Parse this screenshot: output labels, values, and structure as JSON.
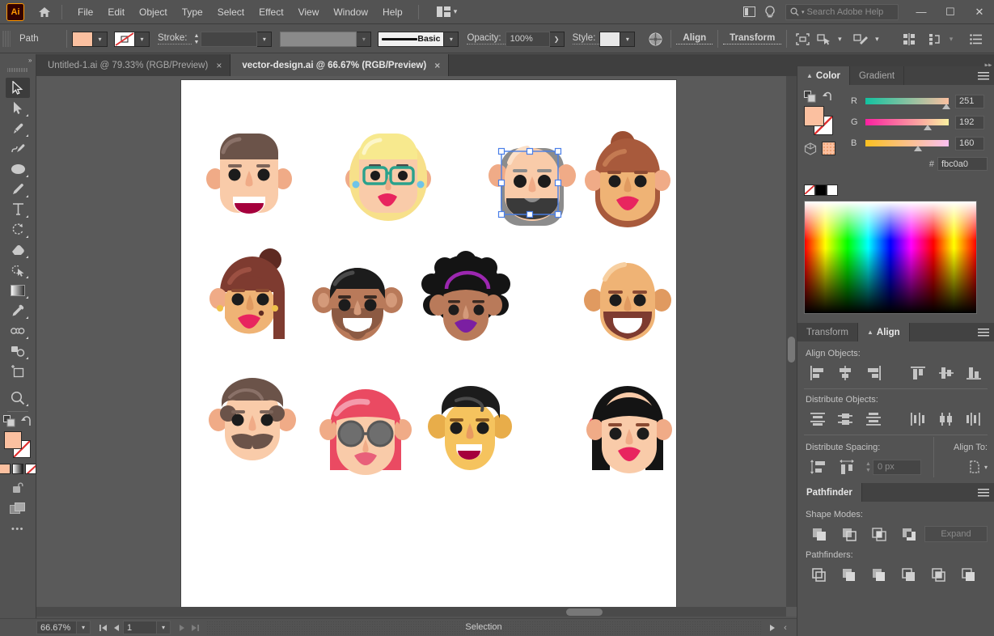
{
  "app": {
    "name": "Ai",
    "logo_color": "#ff9a00"
  },
  "menubar": {
    "items": [
      {
        "label": "File"
      },
      {
        "label": "Edit"
      },
      {
        "label": "Object"
      },
      {
        "label": "Type"
      },
      {
        "label": "Select"
      },
      {
        "label": "Effect"
      },
      {
        "label": "View"
      },
      {
        "label": "Window"
      },
      {
        "label": "Help"
      }
    ],
    "home_icon": "home-icon",
    "arrange_icon": "arrange-documents-icon",
    "properties_icon": "properties-panel-icon",
    "tips_icon": "lightbulb-icon",
    "search": {
      "placeholder": "Search Adobe Help",
      "value": ""
    },
    "window_controls": {
      "minimize": "—",
      "maximize": "☐",
      "close": "✕"
    }
  },
  "controlbar": {
    "object_type": "Path",
    "fill_color": "#fbc0a0",
    "stroke_color": "none",
    "stroke_label": "Stroke:",
    "stroke_weight": "",
    "variable_width": "",
    "brush_label": "Basic",
    "opacity_label": "Opacity:",
    "opacity_value": "100%",
    "style_label": "Style:",
    "style_swatch": "#e8e8e8",
    "align_label": "Align",
    "transform_label": "Transform",
    "icons": [
      "isolate-selected-object-icon",
      "select-similar-objects-icon",
      "recolor-artwork-icon",
      "distribute-icon",
      "arrange-icon",
      "document-setup-icon"
    ]
  },
  "tabs": [
    {
      "label": "Untitled-1.ai @ 79.33% (RGB/Preview)",
      "active": false,
      "close": "×"
    },
    {
      "label": "vector-design.ai @ 66.67% (RGB/Preview)",
      "active": true,
      "close": "×"
    }
  ],
  "toolbar": {
    "expand_chevron": "»",
    "tools": [
      {
        "name": "selection-tool",
        "active": true,
        "has_flyout": false
      },
      {
        "name": "direct-selection-tool",
        "active": false,
        "has_flyout": true
      },
      {
        "name": "pen-tool",
        "active": false,
        "has_flyout": true
      },
      {
        "name": "curvature-tool",
        "active": false,
        "has_flyout": false
      },
      {
        "name": "ellipse-tool",
        "active": false,
        "has_flyout": true
      },
      {
        "name": "paintbrush-tool",
        "active": false,
        "has_flyout": true
      },
      {
        "name": "type-tool",
        "active": false,
        "has_flyout": true
      },
      {
        "name": "rotate-tool",
        "active": false,
        "has_flyout": true
      },
      {
        "name": "eraser-tool",
        "active": false,
        "has_flyout": true
      },
      {
        "name": "shaper-tool",
        "active": false,
        "has_flyout": true
      },
      {
        "name": "gradient-tool",
        "active": false,
        "has_flyout": true
      },
      {
        "name": "eyedropper-tool",
        "active": false,
        "has_flyout": true
      },
      {
        "name": "blend-tool",
        "active": false,
        "has_flyout": true
      },
      {
        "name": "shape-builder-tool",
        "active": false,
        "has_flyout": true
      },
      {
        "name": "artboard-tool",
        "active": false,
        "has_flyout": false
      },
      {
        "name": "zoom-tool",
        "active": false,
        "has_flyout": true
      }
    ],
    "fill_color": "#fbc0a0",
    "stroke_color": "none",
    "more_tools": "•••"
  },
  "canvas": {
    "artboard_bg": "#ffffff",
    "selection": {
      "color": "#4a7fe8",
      "target": "avatar-bald-man-gray-beard",
      "handles": 8
    },
    "avatars": [
      {
        "id": "avatar-brown-hair-man",
        "row": 1,
        "col": 1,
        "skin": "#f7c9a8",
        "hair": "#6b544b",
        "mouth": "#c2185b"
      },
      {
        "id": "avatar-blonde-glasses-woman",
        "row": 1,
        "col": 2,
        "skin": "#f7c9a8",
        "hair": "#f7e98e",
        "glasses": "#2fa08a",
        "mouth": "#e8255f"
      },
      {
        "id": "avatar-bald-man-gray-beard",
        "row": 1,
        "col": 3,
        "skin": "#f7c9a8",
        "beard": "#8c8c8c",
        "selected": true
      },
      {
        "id": "avatar-bun-brown-woman",
        "row": 1,
        "col": 4,
        "skin": "#f0b97e",
        "hair": "#8a4a3a",
        "mouth": "#e8255f"
      },
      {
        "id": "avatar-redhead-bun-woman",
        "row": 2,
        "col": 1,
        "skin": "#f0b97e",
        "hair": "#7e3b30",
        "mouth": "#e8255f"
      },
      {
        "id": "avatar-beard-man",
        "row": 2,
        "col": 2,
        "skin": "#b97a5a",
        "hair": "#1c1c1c",
        "beard": "#8c5a43"
      },
      {
        "id": "avatar-afro-woman",
        "row": 2,
        "col": 3,
        "skin": "#b97a5a",
        "hair": "#141414",
        "headband": "#9c27b0",
        "mouth": "#7b1fa2"
      },
      {
        "id": "avatar-bald-beard-man",
        "row": 2,
        "col": 4,
        "skin": "#f0b97e",
        "beard": "#7e3b30"
      },
      {
        "id": "avatar-mustache-man",
        "row": 3,
        "col": 1,
        "skin": "#f7c9a8",
        "hair": "#6b544b",
        "mustache": "#6b544b"
      },
      {
        "id": "avatar-pinkhair-sunglasses-woman",
        "row": 3,
        "col": 2,
        "skin": "#f7c9a8",
        "hair": "#ea4a62",
        "sunglasses": "#5a5a5a"
      },
      {
        "id": "avatar-young-man",
        "row": 3,
        "col": 3,
        "skin": "#f5c35e",
        "hair": "#1c1c1c",
        "mouth": "#c2185b"
      },
      {
        "id": "avatar-blackhair-flower-woman",
        "row": 3,
        "col": 4,
        "skin": "#f7c9a8",
        "hair": "#141414",
        "flower": "#ea4a62",
        "mouth": "#e8255f"
      }
    ]
  },
  "color_panel": {
    "tabs": [
      {
        "label": "Color",
        "active": true
      },
      {
        "label": "Gradient",
        "active": false
      }
    ],
    "channels": [
      {
        "label": "R",
        "value": "251",
        "pos": 0.985
      },
      {
        "label": "G",
        "value": "192",
        "pos": 0.755
      },
      {
        "label": "B",
        "value": "160",
        "pos": 0.627
      }
    ],
    "hex_label": "#",
    "hex_value": "fbc0a0",
    "fill_color": "#fbc0a0",
    "quick_swatches": [
      "none",
      "#000000",
      "#ffffff"
    ]
  },
  "align_panel": {
    "tabs": [
      {
        "label": "Transform",
        "active": false
      },
      {
        "label": "Align",
        "active": true
      }
    ],
    "align_objects_label": "Align Objects:",
    "align_buttons": [
      "horizontal-align-left-icon",
      "horizontal-align-center-icon",
      "horizontal-align-right-icon",
      "vertical-align-top-icon",
      "vertical-align-center-icon",
      "vertical-align-bottom-icon"
    ],
    "distribute_objects_label": "Distribute Objects:",
    "distribute_buttons": [
      "vertical-distribute-top-icon",
      "vertical-distribute-center-icon",
      "vertical-distribute-bottom-icon",
      "horizontal-distribute-left-icon",
      "horizontal-distribute-center-icon",
      "horizontal-distribute-right-icon"
    ],
    "distribute_spacing_label": "Distribute Spacing:",
    "spacing_value": "0 px",
    "align_to_label": "Align To:"
  },
  "pathfinder_panel": {
    "tabs": [
      {
        "label": "Pathfinder",
        "active": true
      }
    ],
    "shape_modes_label": "Shape Modes:",
    "shape_mode_buttons": [
      "unite-icon",
      "minus-front-icon",
      "intersect-icon",
      "exclude-icon"
    ],
    "expand_label": "Expand",
    "pathfinders_label": "Pathfinders:",
    "pathfinder_buttons": [
      "divide-icon",
      "trim-icon",
      "merge-icon",
      "crop-icon",
      "outline-icon",
      "minus-back-icon"
    ]
  },
  "statusbar": {
    "zoom": "66.67%",
    "page": "1",
    "status_text": "Selection",
    "nav_first": "⏮",
    "nav_prev": "◀",
    "nav_next": "▶",
    "nav_last": "⏭"
  }
}
